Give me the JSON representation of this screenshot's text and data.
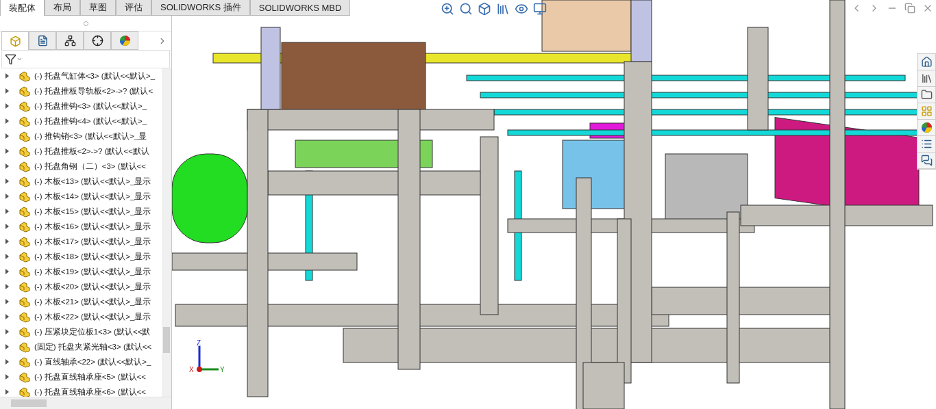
{
  "command_tabs": [
    {
      "label": "装配体",
      "selected": true
    },
    {
      "label": "布局",
      "selected": false
    },
    {
      "label": "草图",
      "selected": false
    },
    {
      "label": "评估",
      "selected": false
    },
    {
      "label": "SOLIDWORKS 插件",
      "selected": false
    },
    {
      "label": "SOLIDWORKS MBD",
      "selected": false
    }
  ],
  "panel_tabs": [
    {
      "kind": "tree",
      "selected": true
    },
    {
      "kind": "property",
      "selected": false
    },
    {
      "kind": "config",
      "selected": false
    },
    {
      "kind": "dim",
      "selected": false
    },
    {
      "kind": "display",
      "selected": false
    }
  ],
  "tree": {
    "items": [
      {
        "label": "(-) 托盘气缸体<3> (默认<<默认>_",
        "expanded": false
      },
      {
        "label": "(-) 托盘推板导轨板<2>->? (默认<",
        "expanded": false
      },
      {
        "label": "(-) 托盘推钩<3> (默认<<默认>_",
        "expanded": false
      },
      {
        "label": "(-) 托盘推钩<4> (默认<<默认>_",
        "expanded": false
      },
      {
        "label": "(-) 推钩销<3> (默认<<默认>_显",
        "expanded": false
      },
      {
        "label": "(-) 托盘推板<2>->? (默认<<默认",
        "expanded": false
      },
      {
        "label": "(-) 托盘角钢（二）<3> (默认<<",
        "expanded": false
      },
      {
        "label": "(-) 木板<13> (默认<<默认>_显示",
        "expanded": false
      },
      {
        "label": "(-) 木板<14> (默认<<默认>_显示",
        "expanded": false
      },
      {
        "label": "(-) 木板<15> (默认<<默认>_显示",
        "expanded": false
      },
      {
        "label": "(-) 木板<16> (默认<<默认>_显示",
        "expanded": false
      },
      {
        "label": "(-) 木板<17> (默认<<默认>_显示",
        "expanded": false
      },
      {
        "label": "(-) 木板<18> (默认<<默认>_显示",
        "expanded": false
      },
      {
        "label": "(-) 木板<19> (默认<<默认>_显示",
        "expanded": false
      },
      {
        "label": "(-) 木板<20> (默认<<默认>_显示",
        "expanded": false
      },
      {
        "label": "(-) 木板<21> (默认<<默认>_显示",
        "expanded": false
      },
      {
        "label": "(-) 木板<22> (默认<<默认>_显示",
        "expanded": false
      },
      {
        "label": "(-) 压紧块定位板1<3> (默认<<默",
        "expanded": false
      },
      {
        "label": "(固定) 托盘夹紧光轴<3> (默认<<",
        "expanded": false
      },
      {
        "label": "(-) 直线轴承<22> (默认<<默认>_",
        "expanded": false
      },
      {
        "label": "(-) 托盘直线轴承座<5> (默认<<",
        "expanded": false
      },
      {
        "label": "(-) 托盘直线轴承座<6> (默认<<",
        "expanded": false
      }
    ]
  },
  "triad": {
    "x": "X",
    "y": "Y",
    "z": "Z"
  }
}
